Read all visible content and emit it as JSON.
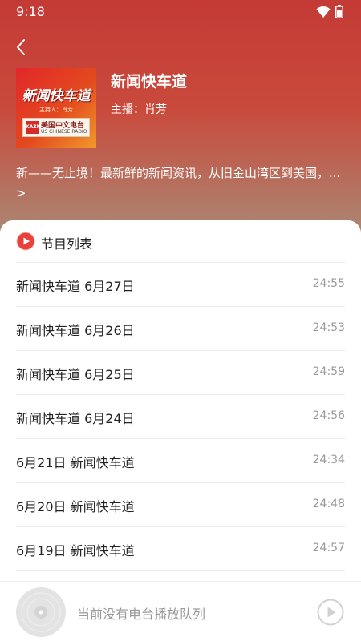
{
  "status_bar": {
    "time": "9:18"
  },
  "program": {
    "title": "新闻快车道",
    "host": "主播：肖芳",
    "description": "新——无止境！最新鲜的新闻资讯，从旧金山湾区到美国，... >",
    "cover": {
      "title": "新闻快车道",
      "subtitle": "主持人：肖芳",
      "logo_mark": "KAZN",
      "logo_cn": "美国中文电台",
      "logo_en": "US CHINESE RADIO"
    }
  },
  "episode_list": {
    "header": "节目列表",
    "items": [
      {
        "title": "新闻快车道 6月27日",
        "duration": "24:55"
      },
      {
        "title": "新闻快车道 6月26日",
        "duration": "24:53"
      },
      {
        "title": "新闻快车道 6月25日",
        "duration": "24:59"
      },
      {
        "title": "新闻快车道 6月24日",
        "duration": "24:56"
      },
      {
        "title": "6月21日 新闻快车道",
        "duration": "24:34"
      },
      {
        "title": "6月20日 新闻快车道",
        "duration": "24:48"
      },
      {
        "title": "6月19日 新闻快车道",
        "duration": "24:57"
      }
    ]
  },
  "mini_player": {
    "status": "当前没有电台播放队列"
  },
  "colors": {
    "accent": "#e8413c",
    "hero_top": "#c43a36",
    "hero_bottom": "#a98a76"
  },
  "icons": [
    "back-icon",
    "wifi-icon",
    "battery-icon",
    "play-circle-icon",
    "disc-icon",
    "play-outline-icon"
  ]
}
